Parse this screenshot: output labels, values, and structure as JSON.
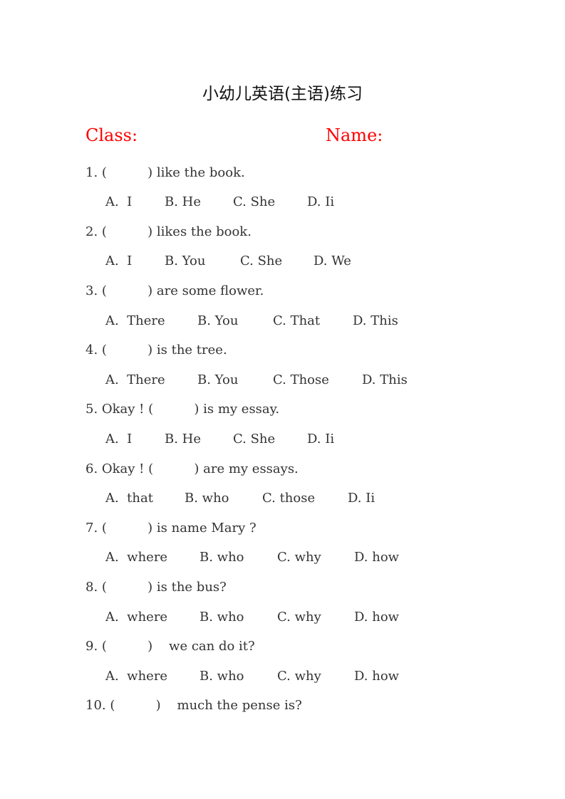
{
  "title": "小幼儿英语(主语)练习",
  "header": {
    "class_label": "Class:",
    "name_label": "Name:",
    "label_color": "#ff0000"
  },
  "questions": [
    {
      "stem": "1. (          ) like the book.",
      "options": [
        "A.  I",
        "B. He",
        "C. She",
        "D. Ii"
      ]
    },
    {
      "stem": "2. (          ) likes the book.",
      "options": [
        "A.  I",
        "B. You",
        "C. She",
        "D. We"
      ]
    },
    {
      "stem": "3. (          ) are some flower.",
      "options": [
        "A.  There",
        "B. You",
        "C. That",
        "D. This"
      ]
    },
    {
      "stem": "4. (          ) is the tree.",
      "options": [
        "A.  There",
        "B. You",
        "C. Those",
        "D. This"
      ]
    },
    {
      "stem": "5. Okay ! (          ) is my essay.",
      "options": [
        "A.  I",
        "B. He",
        "C. She",
        "D. Ii"
      ]
    },
    {
      "stem": "6. Okay ! (          ) are my essays.",
      "options": [
        "A.  that",
        "B. who",
        "C. those",
        "D. Ii"
      ]
    },
    {
      "stem": "7. (          ) is name Mary ?",
      "options": [
        "A.  where",
        "B. who",
        "C. why",
        "D. how"
      ]
    },
    {
      "stem": "8. (          ) is the bus?",
      "options": [
        "A.  where",
        "B. who",
        "C. why",
        "D. how"
      ]
    },
    {
      "stem": "9. (          )    we can do it?",
      "options": [
        "A.  where",
        "B. who",
        "C. why",
        "D. how"
      ]
    },
    {
      "stem": "10. (          )    much the pense is?",
      "options": []
    }
  ]
}
